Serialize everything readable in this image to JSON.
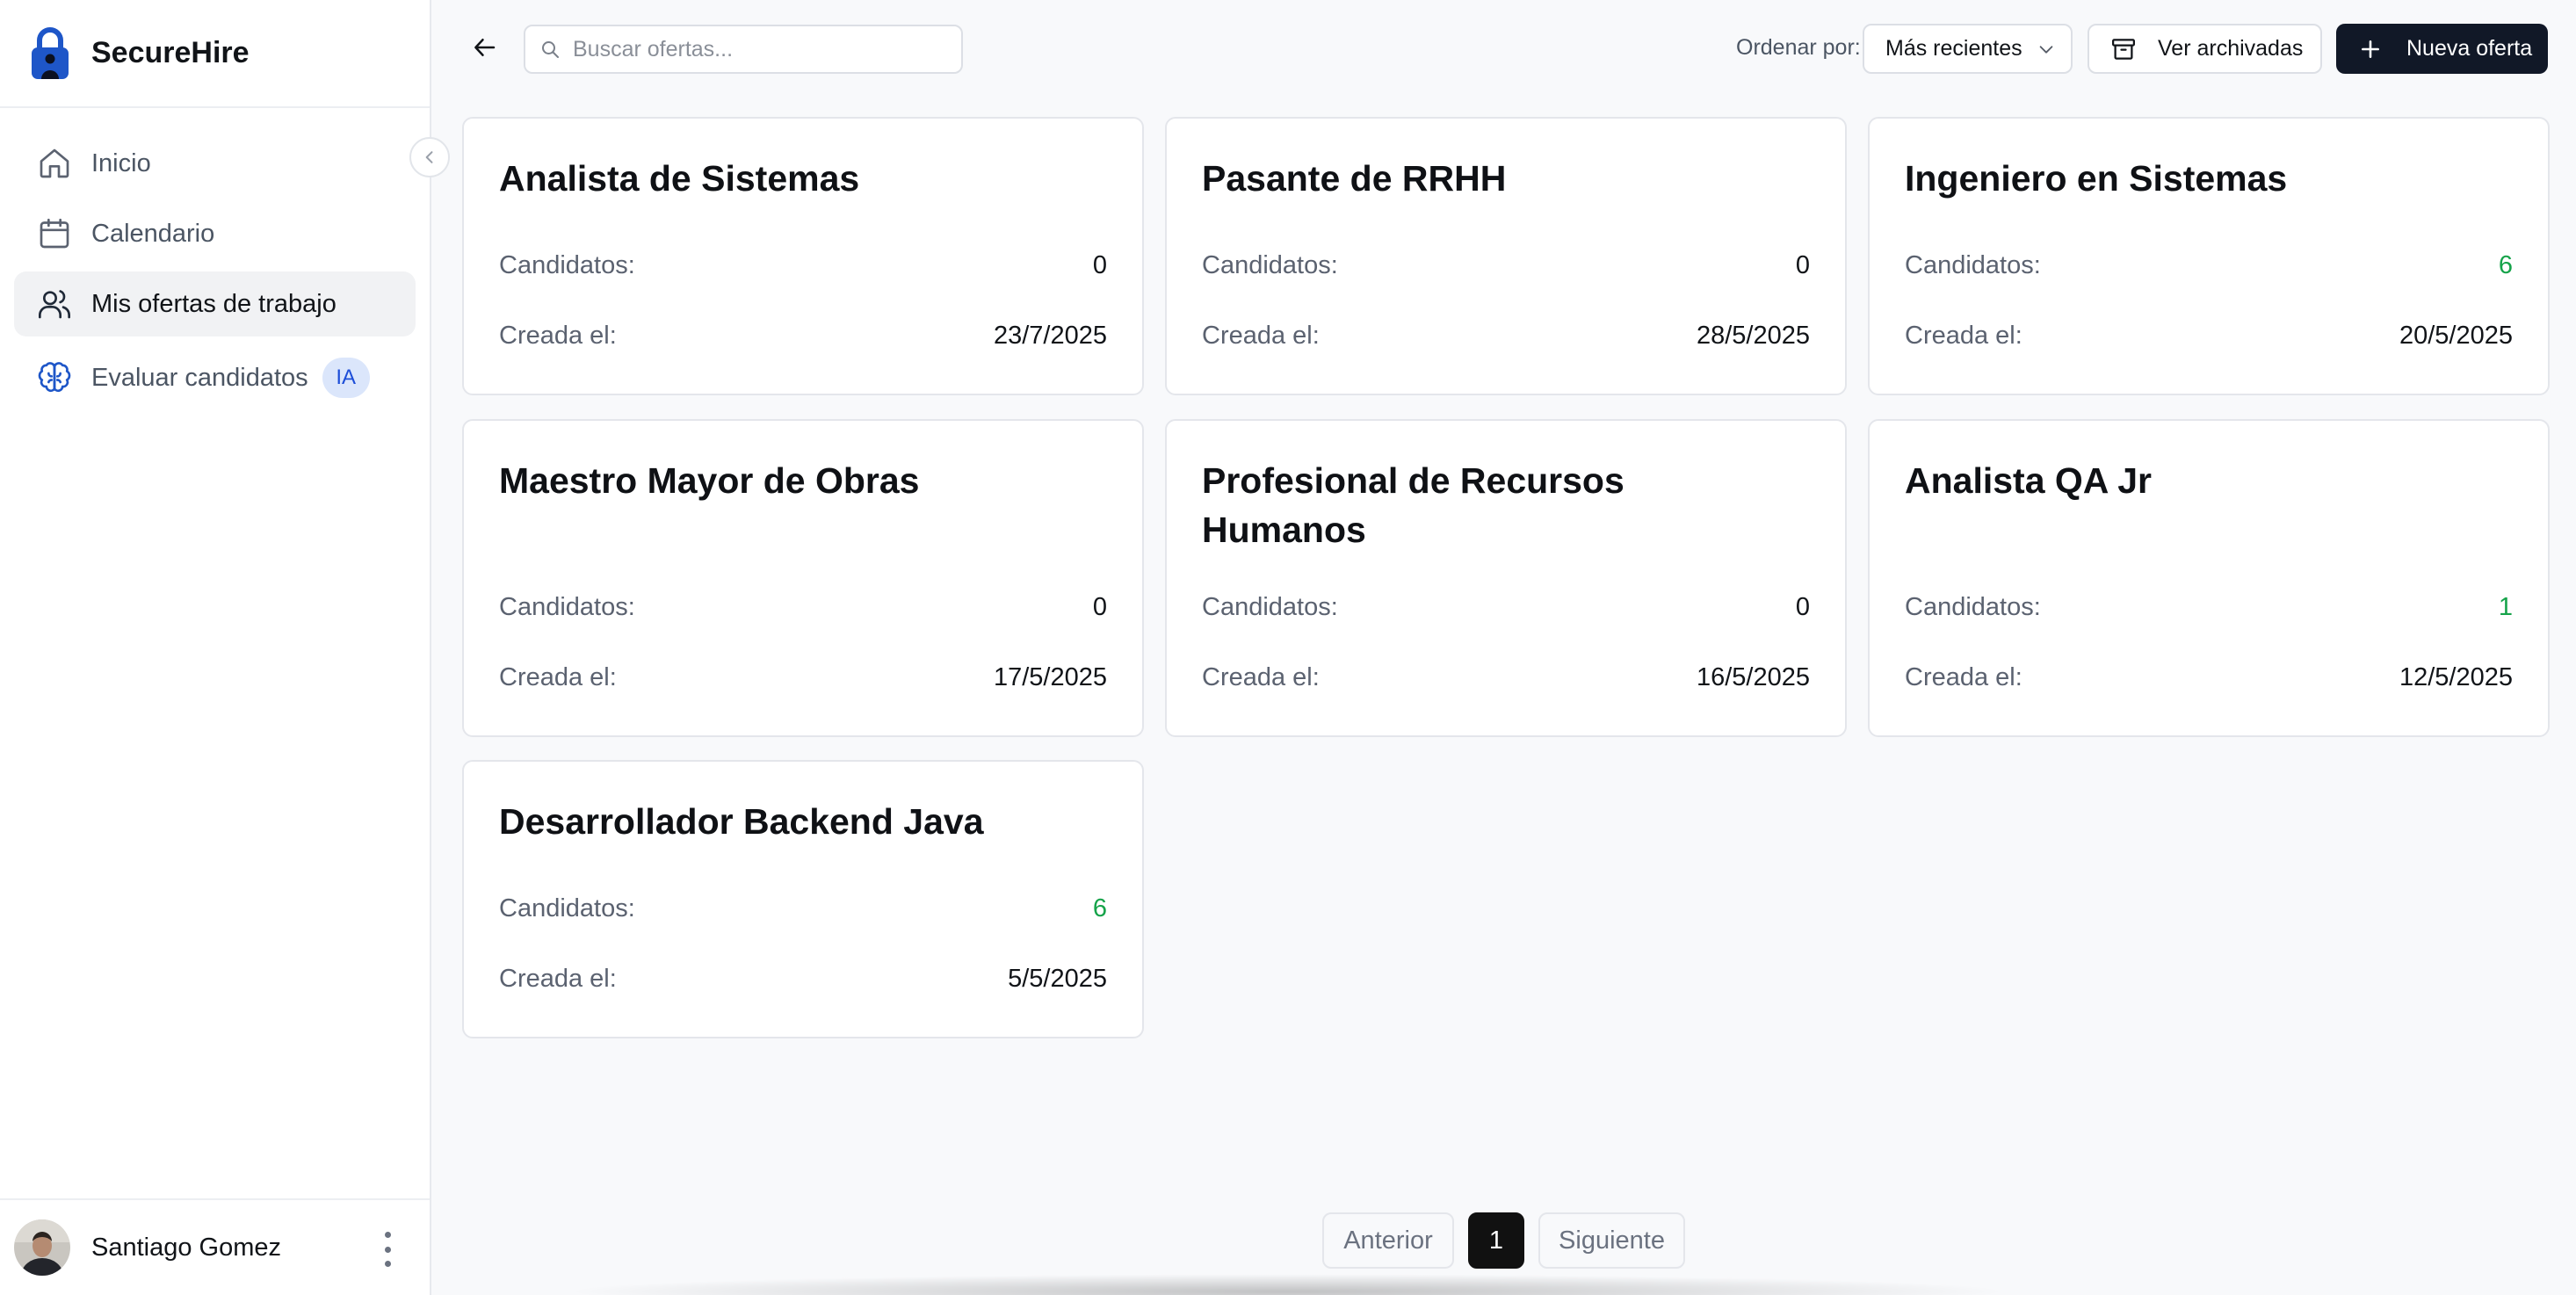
{
  "app": {
    "name": "SecureHire",
    "accent": "#1e56c8"
  },
  "sidebar": {
    "items": [
      {
        "label": "Inicio",
        "icon": "home-icon"
      },
      {
        "label": "Calendario",
        "icon": "calendar-icon"
      },
      {
        "label": "Mis ofertas de trabajo",
        "icon": "users-icon",
        "active": true
      },
      {
        "label": "Evaluar candidatos",
        "icon": "brain-icon",
        "badge": "IA"
      }
    ],
    "user": {
      "name": "Santiago Gomez"
    }
  },
  "toolbar": {
    "search_placeholder": "Buscar ofertas...",
    "sort_label": "Ordenar por:",
    "sort_value": "Más recientes",
    "archived_label": "Ver archivadas",
    "new_label": "Nueva oferta"
  },
  "labels": {
    "candidates": "Candidatos:",
    "created": "Creada el:"
  },
  "jobs": [
    {
      "title": "Analista de Sistemas",
      "candidates": "0",
      "created": "23/7/2025"
    },
    {
      "title": "Pasante de RRHH",
      "candidates": "0",
      "created": "28/5/2025"
    },
    {
      "title": "Ingeniero en Sistemas",
      "candidates": "6",
      "created": "20/5/2025"
    },
    {
      "title": "Maestro Mayor de Obras",
      "candidates": "0",
      "created": "17/5/2025"
    },
    {
      "title": "Profesional de Recursos Humanos",
      "candidates": "0",
      "created": "16/5/2025"
    },
    {
      "title": "Analista QA Jr",
      "candidates": "1",
      "created": "12/5/2025"
    },
    {
      "title": "Desarrollador Backend Java",
      "candidates": "6",
      "created": "5/5/2025"
    }
  ],
  "pagination": {
    "prev_label": "Anterior",
    "current_page": "1",
    "next_label": "Siguiente"
  },
  "colors": {
    "positive_count": "#16a34a",
    "primary_button": "#111827"
  }
}
